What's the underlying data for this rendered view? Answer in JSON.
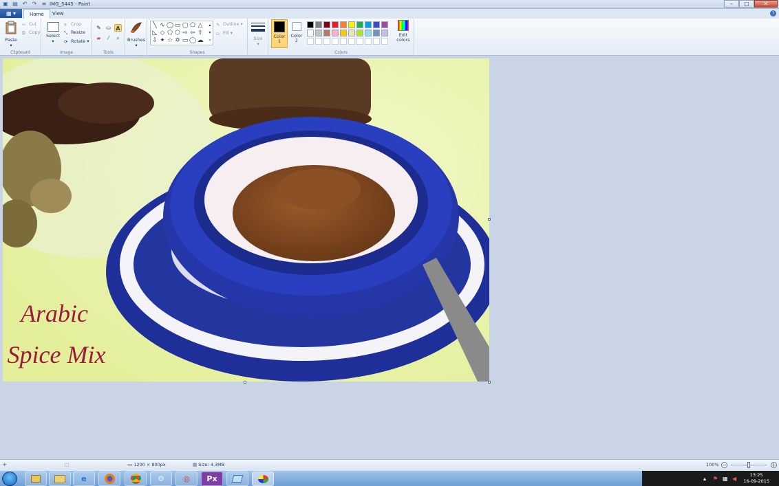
{
  "window": {
    "title": "IMG_5445 - Paint",
    "controls": [
      "–",
      "▢",
      "✕"
    ]
  },
  "tabs": {
    "file": "▦ ▾",
    "home": "Home",
    "view": "View",
    "help": "?"
  },
  "ribbon": {
    "clipboard": {
      "label": "Clipboard",
      "paste": "Paste",
      "cut": "Cut",
      "copy": "Copy"
    },
    "image": {
      "label": "Image",
      "select": "Select",
      "crop": "Crop",
      "resize": "Resize",
      "rotate": "Rotate"
    },
    "tools": {
      "label": "Tools"
    },
    "brushes": {
      "label": "Brushes"
    },
    "shapes": {
      "label": "Shapes",
      "outline": "Outline",
      "fill": "Fill"
    },
    "size": {
      "label": "Size"
    },
    "colors": {
      "label": "Colors",
      "color1": "Color 1",
      "color2": "Color 2",
      "edit": "Edit colors",
      "palette_row1": [
        "#000000",
        "#7f7f7f",
        "#880015",
        "#ed1c24",
        "#ff7f27",
        "#fff200",
        "#22b14c",
        "#00a2e8",
        "#3f48cc",
        "#a349a4"
      ],
      "palette_row2": [
        "#ffffff",
        "#c3c3c3",
        "#b97a57",
        "#ffaec9",
        "#ffc90e",
        "#efe4b0",
        "#b5e61d",
        "#99d9ea",
        "#7092be",
        "#c8bfe7"
      ]
    }
  },
  "canvas": {
    "caption_line1": "Arabic",
    "caption_line2": "Spice Mix"
  },
  "status": {
    "dimensions": "1200 × 800px",
    "size": "Size: 4.3MB",
    "zoom": "100%"
  },
  "taskbar": {
    "apps": [
      "explorer",
      "file-manager",
      "internet-explorer",
      "firefox",
      "chrome",
      "app-settings",
      "app-circle",
      "px-app",
      "app-window",
      "paint"
    ],
    "px_label": "Px",
    "time": "13:25",
    "date": "16-09-2015"
  }
}
